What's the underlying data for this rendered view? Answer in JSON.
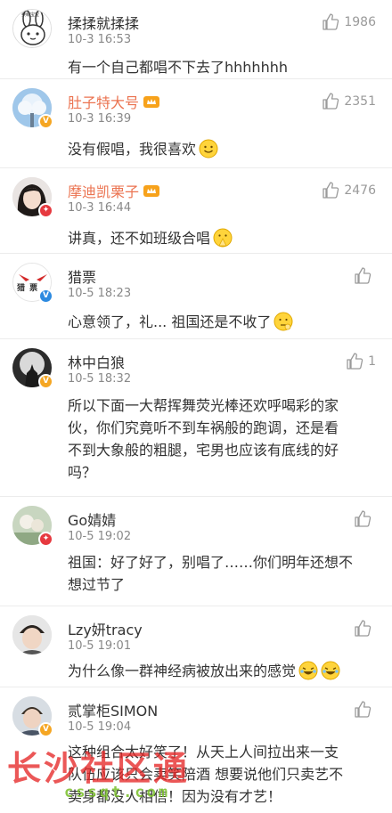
{
  "comments": [
    {
      "username": "揉揉就揉揉",
      "time": "10-3 16:53",
      "likes": "1986",
      "text": "有一个自己都唱不下去了hhhhhhh",
      "avatar_caption": "卖萌宝宝"
    },
    {
      "username": "肚子特大号",
      "time": "10-3 16:39",
      "likes": "2351",
      "text": "没有假唱，我很喜欢"
    },
    {
      "username": "摩迪凯栗子",
      "time": "10-3 16:44",
      "likes": "2476",
      "text": "讲真，还不如班级合唱"
    },
    {
      "username": "猎票",
      "time": "10-5 18:23",
      "likes": "",
      "text": "心意领了，礼... 祖国还是不收了",
      "avatar_caption": "猎 票"
    },
    {
      "username": "林中白狼",
      "time": "10-5 18:32",
      "likes": "1",
      "text_lines": [
        "所以下面一大帮挥舞荧光棒还欢呼喝彩的家",
        "伙，你们究竟听不到车祸般的跑调，还是看",
        "不到大象般的粗腿，宅男也应该有底线的好",
        "吗？"
      ]
    },
    {
      "username": "Go婧婧",
      "time": "10-5 19:02",
      "likes": "",
      "text_lines": [
        "祖国：好了好了，别唱了……你们明年还想不",
        "想过节了"
      ]
    },
    {
      "username": "Lzy妍tracy",
      "time": "10-5 19:01",
      "likes": "",
      "text": "为什么像一群神经病被放出来的感觉"
    },
    {
      "username": "贰掌柜SIMON",
      "time": "10-5 19:04",
      "likes": "",
      "text_lines": [
        "这种组合太好笑了！从天上人间拉出来一支",
        "队伍应该只会卖笑陪酒 想要说他们只卖艺不",
        "卖身都没人相信！因为没有才艺！"
      ]
    }
  ],
  "watermark": {
    "title": "长沙社区通",
    "url": "cssqt.com"
  },
  "colors": {
    "vip_name": "#eb7350",
    "normal_name": "#333333",
    "meta": "#888888",
    "like": "#9a9a9a",
    "divider": "#ececec"
  }
}
